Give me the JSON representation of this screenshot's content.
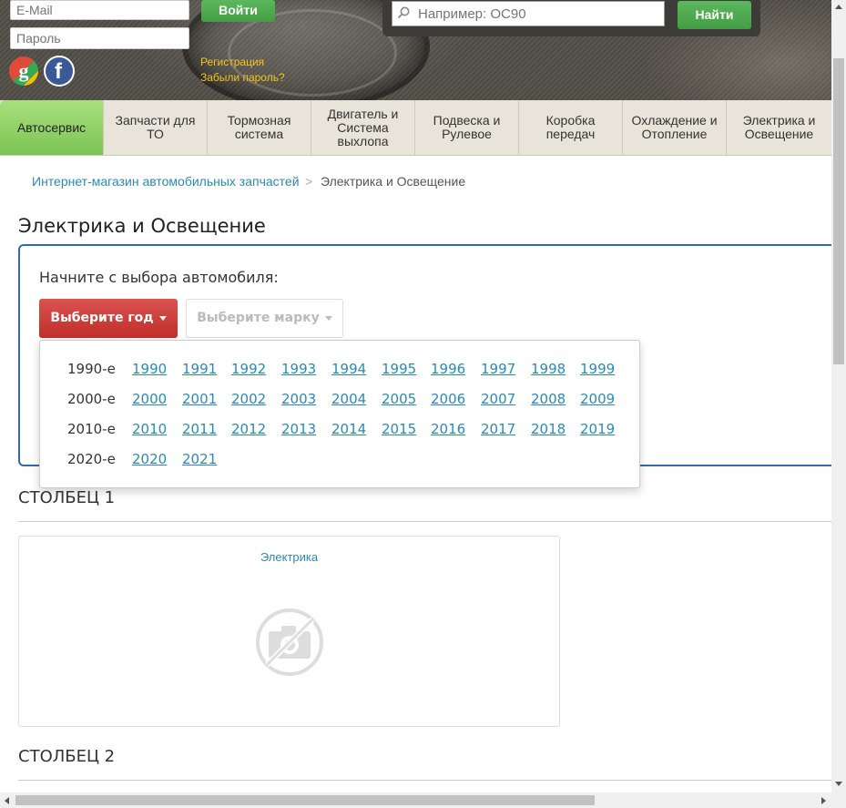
{
  "login": {
    "email_placeholder": "E-Mail",
    "password_placeholder": "Пароль",
    "login_button": "Войти",
    "register_link": "Регистрация",
    "forgot_link": "Забыли пароль?"
  },
  "search": {
    "placeholder": "Например: OC90",
    "button": "Найти"
  },
  "nav": {
    "items": [
      {
        "label": "Автосервис"
      },
      {
        "label": "Запчасти для ТО"
      },
      {
        "label": "Тормозная система"
      },
      {
        "label": "Двигатель и Система выхлопа"
      },
      {
        "label": "Подвеска и Рулевое"
      },
      {
        "label": "Коробка передач"
      },
      {
        "label": "Охлаждение и Отопление"
      },
      {
        "label": "Электрика и Освещение"
      }
    ]
  },
  "breadcrumb": {
    "home": "Интернет-магазин автомобильных запчастей",
    "separator": ">",
    "current": "Электрика и Освещение"
  },
  "page_title": "Электрика и Освещение",
  "selector": {
    "prompt": "Начните с выбора автомобиля:",
    "year_button": "Выберите год",
    "make_button": "Выберите марку"
  },
  "years": [
    {
      "decade": "1990-е",
      "years": [
        "1990",
        "1991",
        "1992",
        "1993",
        "1994",
        "1995",
        "1996",
        "1997",
        "1998",
        "1999"
      ]
    },
    {
      "decade": "2000-е",
      "years": [
        "2000",
        "2001",
        "2002",
        "2003",
        "2004",
        "2005",
        "2006",
        "2007",
        "2008",
        "2009"
      ]
    },
    {
      "decade": "2010-е",
      "years": [
        "2010",
        "2011",
        "2012",
        "2013",
        "2014",
        "2015",
        "2016",
        "2017",
        "2018",
        "2019"
      ]
    },
    {
      "decade": "2020-е",
      "years": [
        "2020",
        "2021"
      ]
    }
  ],
  "columns": [
    {
      "title": "СТОЛБЕЦ 1",
      "card_link": "Электрика"
    },
    {
      "title": "СТОЛБЕЦ 2"
    }
  ],
  "colors": {
    "accent_green": "#5cb85c",
    "accent_red": "#d9534f",
    "link_blue": "#2a8ab5",
    "panel_border": "#2d6ea7"
  }
}
